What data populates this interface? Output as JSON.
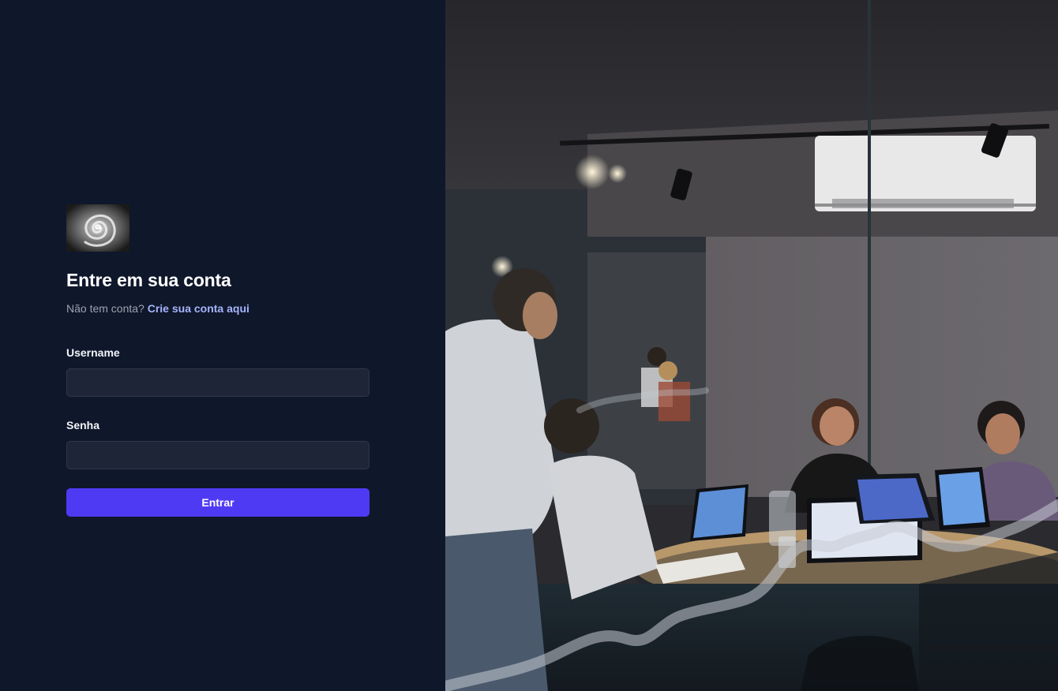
{
  "login": {
    "logo_icon": "spiral-logo-icon",
    "title": "Entre em sua conta",
    "no_account_text": "Não tem conta?",
    "create_account_link": "Crie sua conta aqui",
    "username_label": "Username",
    "username_value": "",
    "password_label": "Senha",
    "password_value": "",
    "submit_label": "Entrar"
  },
  "colors": {
    "background": "#0f172a",
    "input_background": "#1e2536",
    "accent_button": "#4f3af4",
    "link": "#a5b4fc"
  },
  "hero": {
    "image_icon": "meeting-room-photo"
  }
}
